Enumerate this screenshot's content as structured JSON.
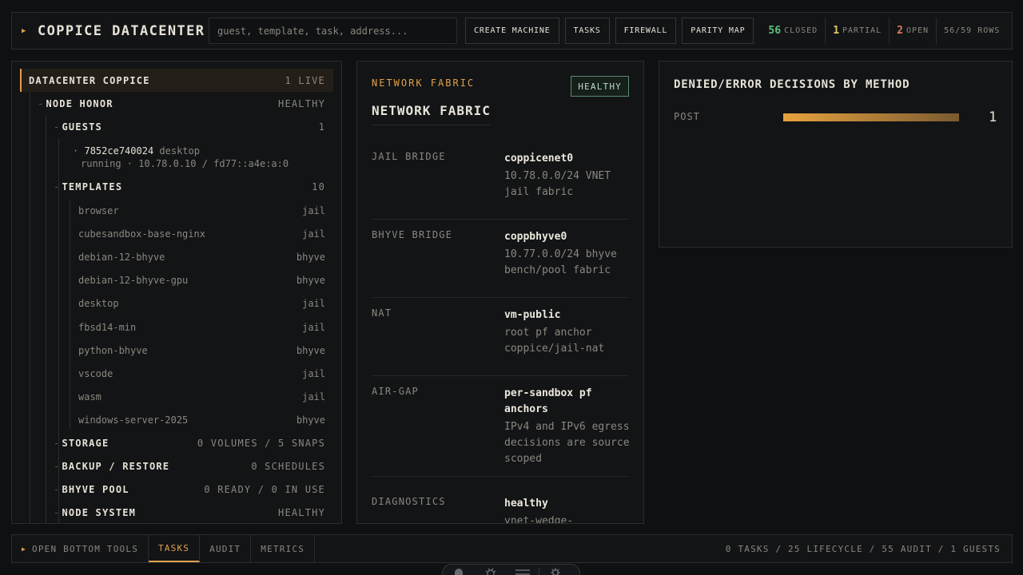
{
  "header": {
    "title": "COPPICE DATACENTER",
    "search_placeholder": "guest, template, task, address...",
    "buttons": [
      "CREATE MACHINE",
      "TASKS",
      "FIREWALL",
      "PARITY MAP"
    ],
    "stats": [
      {
        "n": "56",
        "label": "CLOSED",
        "color": "#5ec27e"
      },
      {
        "n": "1",
        "label": "PARTIAL",
        "color": "#e8c36a"
      },
      {
        "n": "2",
        "label": "OPEN",
        "color": "#e07a5a"
      }
    ],
    "rows": "56/59 ROWS"
  },
  "tree": {
    "datacenter": {
      "label": "DATACENTER COPPICE",
      "value": "1 LIVE"
    },
    "node": {
      "label": "NODE HONOR",
      "value": "HEALTHY"
    },
    "guests": {
      "label": "GUESTS",
      "value": "1"
    },
    "guest": {
      "id": "7852ce740024",
      "type": "desktop",
      "detail": "running · 10.78.0.10 / fd77::a4e:a:0"
    },
    "templates_header": {
      "label": "TEMPLATES",
      "value": "10"
    },
    "templates": [
      {
        "name": "browser",
        "kind": "jail"
      },
      {
        "name": "cubesandbox-base-nginx",
        "kind": "jail"
      },
      {
        "name": "debian-12-bhyve",
        "kind": "bhyve"
      },
      {
        "name": "debian-12-bhyve-gpu",
        "kind": "bhyve"
      },
      {
        "name": "desktop",
        "kind": "jail"
      },
      {
        "name": "fbsd14-min",
        "kind": "jail"
      },
      {
        "name": "python-bhyve",
        "kind": "bhyve"
      },
      {
        "name": "vscode",
        "kind": "jail"
      },
      {
        "name": "wasm",
        "kind": "jail"
      },
      {
        "name": "windows-server-2025",
        "kind": "bhyve"
      }
    ],
    "storage": {
      "label": "STORAGE",
      "value": "0 VOLUMES / 5 SNAPS"
    },
    "backup": {
      "label": "BACKUP / RESTORE",
      "value": "0 SCHEDULES"
    },
    "pool": {
      "label": "BHYVE POOL",
      "value": "0 READY / 0 IN USE"
    },
    "system": {
      "label": "NODE SYSTEM",
      "value": "HEALTHY"
    }
  },
  "fabric": {
    "kicker": "NETWORK FABRIC",
    "badge": "HEALTHY",
    "title": "NETWORK FABRIC",
    "rows": [
      {
        "key": "JAIL BRIDGE",
        "value": "coppicenet0",
        "detail": "10.78.0.0/24 VNET jail fabric"
      },
      {
        "key": "BHYVE BRIDGE",
        "value": "coppbhyve0",
        "detail": "10.77.0.0/24 bhyve bench/pool fabric"
      },
      {
        "key": "NAT",
        "value": "vm-public",
        "detail": "root pf anchor coppice/jail-nat"
      },
      {
        "key": "AIR-GAP",
        "value": "per-sandbox pf anchors",
        "detail": "IPv4 and IPv6 egress decisions are source scoped"
      },
      {
        "key": "DIAGNOSTICS",
        "value": "healthy",
        "detail": "vnet-wedge-"
      }
    ]
  },
  "chart_data": {
    "type": "bar",
    "title": "DENIED/ERROR DECISIONS BY METHOD",
    "categories": [
      "POST"
    ],
    "values": [
      1
    ],
    "value_labels": [
      "1"
    ],
    "colors": {
      "bar_start": "#e8a23e",
      "bar_end": "#7a5a30"
    }
  },
  "bottom": {
    "open_label": "OPEN BOTTOM TOOLS",
    "tabs": [
      "TASKS",
      "AUDIT",
      "METRICS"
    ],
    "active_tab": "TASKS",
    "summary": "0 TASKS / 25 LIFECYCLE / 55 AUDIT / 1 GUESTS"
  },
  "dock": {
    "icons": [
      "ghost-icon",
      "bug-icon",
      "menu-icon",
      "gear-icon"
    ]
  }
}
